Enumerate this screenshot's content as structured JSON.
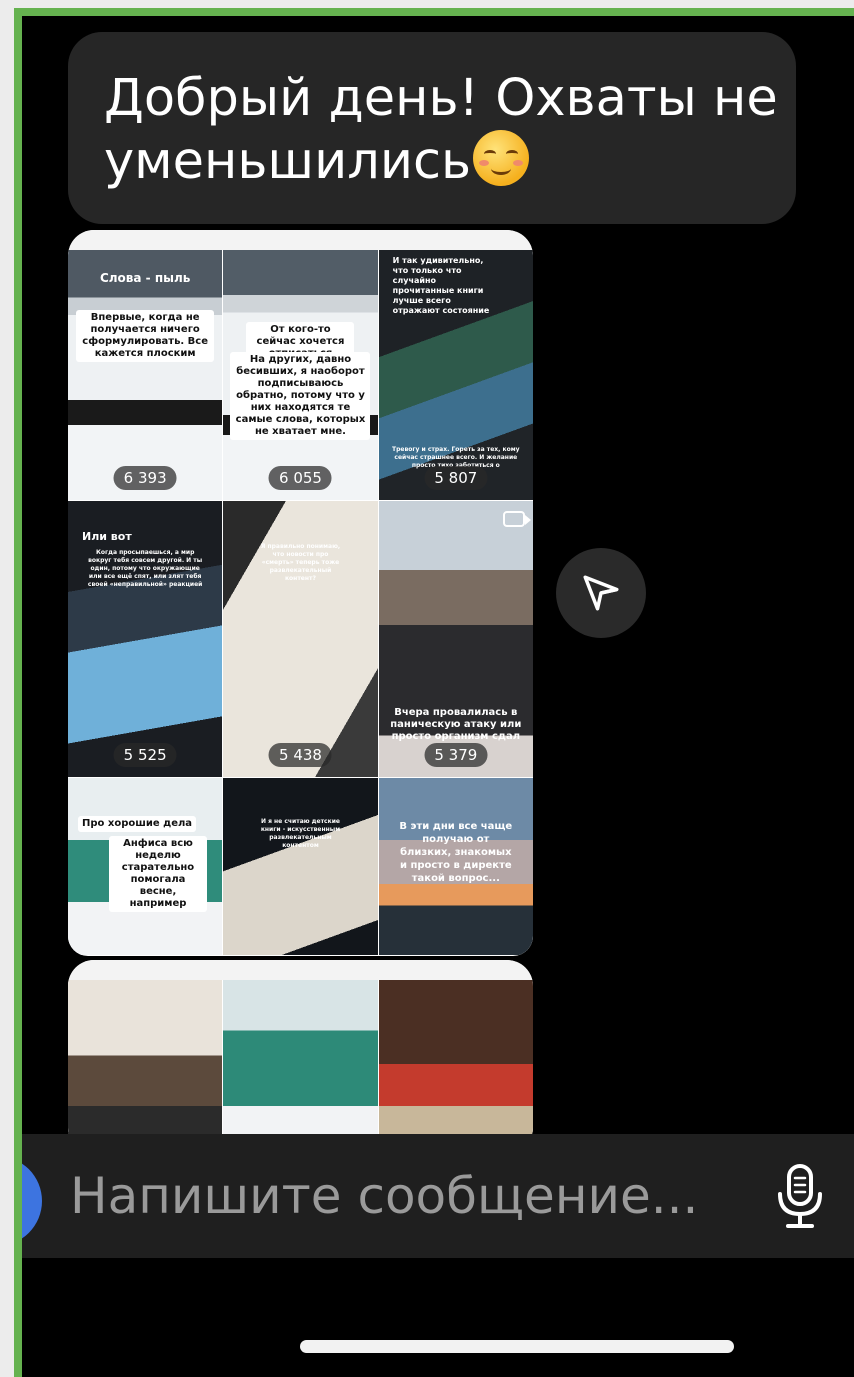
{
  "message": {
    "text": "Добрый день! Охваты не уменьшились",
    "emoji": "smiling-face-with-blush"
  },
  "stories": [
    {
      "captions": [
        "Слова - пыль",
        "Впервые, когда не получается ничего сформулировать. Все кажется плоским"
      ],
      "views": "6 393"
    },
    {
      "captions": [
        "От кого-то сейчас хочется отписаться",
        "На других, давно бесивших, я наоборот подписываюсь обратно, потому что у них находятся те самые слова, которых не хватает мне."
      ],
      "views": "6 055"
    },
    {
      "captions": [
        "И так удивительно, что только что случайно прочитанные книги лучше всего отражают состояние",
        "Тревогу и страх. Гореть за тех, кому сейчас страшнее всего. И желание просто тихо заботиться о"
      ],
      "views": "5 807"
    },
    {
      "captions": [
        "Или вот",
        "Когда просыпаешься, а мир вокруг тебя совсем другой. И ты один, потому что окружающие или все ещё спят, или злят тебя своей «неправильной» реакцией"
      ],
      "views": "5 525"
    },
    {
      "captions": [
        "Я правильно понимаю, что новости про «смерть» теперь тоже развлекательный контент?"
      ],
      "views": "5 438"
    },
    {
      "captions": [
        "Вчера провалилась в паническую атаку или просто организм сдал"
      ],
      "views": "5 379"
    },
    {
      "captions": [
        "Про хорошие дела",
        "Анфиса всю неделю старательно помогала весне, например"
      ],
      "views": ""
    },
    {
      "captions": [
        "И я не считаю детские книги - искусственным развлекательным контентом"
      ],
      "views": ""
    },
    {
      "captions": [
        "В эти дни все чаще получаю от близких, знакомых и просто в директе такой вопрос..."
      ],
      "views": ""
    }
  ],
  "composer": {
    "placeholder": "Напишите сообщение..."
  }
}
